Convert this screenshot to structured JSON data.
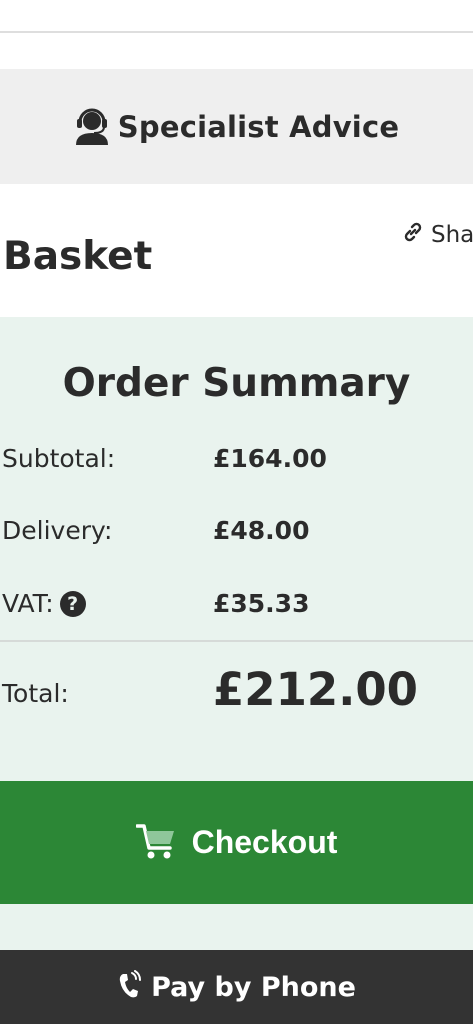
{
  "header": {
    "specialist_advice": "Specialist Advice"
  },
  "basket": {
    "title": "Basket",
    "share_label": "Share"
  },
  "order_summary": {
    "title": "Order Summary",
    "subtotal_label": "Subtotal:",
    "subtotal_value": "£164.00",
    "delivery_label": "Delivery:",
    "delivery_value": "£48.00",
    "vat_label": "VAT:",
    "vat_help_symbol": "?",
    "vat_value": "£35.33",
    "total_label": "Total:",
    "total_value": "£212.00"
  },
  "actions": {
    "checkout_label": "Checkout",
    "pay_by_phone_label": "Pay by Phone"
  },
  "colors": {
    "checkout_green": "#2c8736",
    "summary_background": "#e9f3ee",
    "phone_bar": "#333333",
    "text": "#2b2b2b"
  },
  "icons": [
    "headset-icon",
    "link-icon",
    "question-circle-icon",
    "cart-icon",
    "phone-icon"
  ]
}
